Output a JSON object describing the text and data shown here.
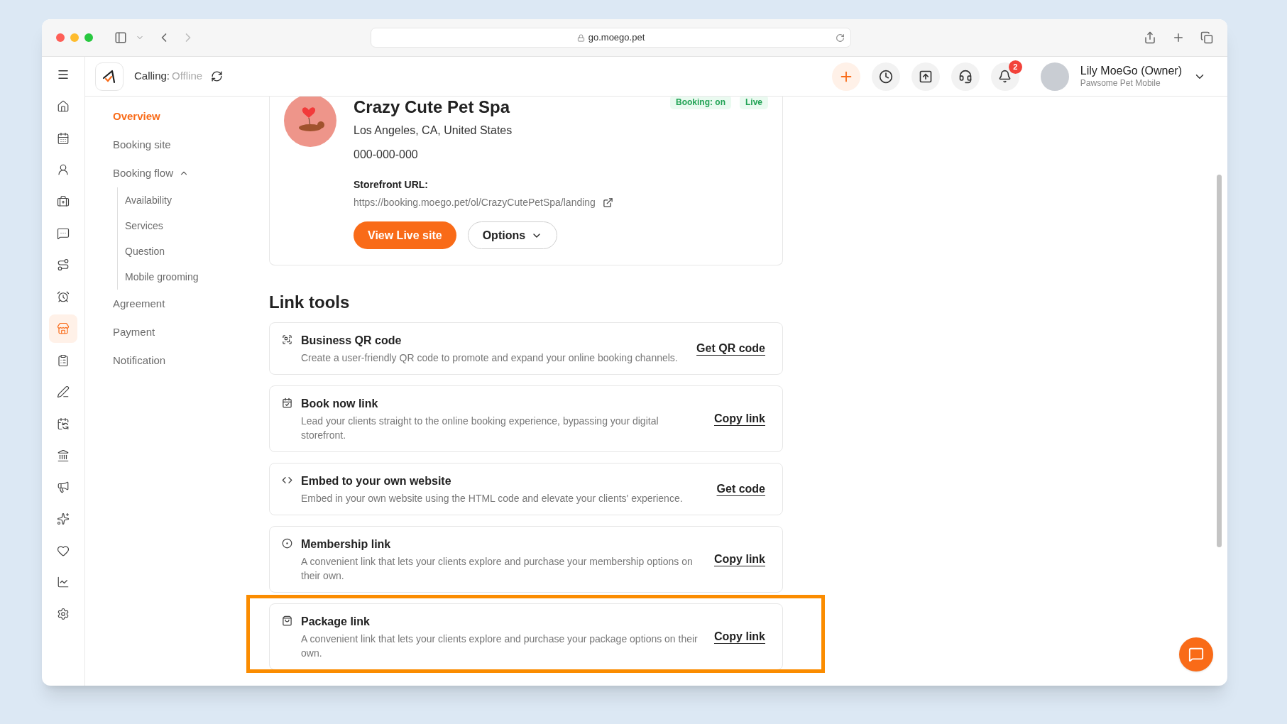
{
  "browser": {
    "url": "go.moego.pet"
  },
  "header": {
    "calling_label": "Calling:",
    "calling_status": "Offline",
    "notification_count": "2",
    "user_name": "Lily MoeGo (Owner)",
    "business_name": "Pawsome Pet Mobile"
  },
  "rail": [
    {
      "selected": false
    },
    {
      "selected": false
    },
    {
      "selected": false
    },
    {
      "selected": false
    },
    {
      "selected": false
    },
    {
      "selected": false
    },
    {
      "selected": false
    },
    {
      "selected": true
    },
    {
      "selected": false
    },
    {
      "selected": false
    },
    {
      "selected": false
    },
    {
      "selected": false
    },
    {
      "selected": false
    },
    {
      "selected": false
    },
    {
      "selected": false
    },
    {
      "selected": false
    },
    {
      "selected": false
    }
  ],
  "subnav": [
    {
      "label": "Overview",
      "selected": true
    },
    {
      "label": "Booking site",
      "selected": false
    },
    {
      "label": "Booking flow",
      "selected": false,
      "expanded": true,
      "children": [
        {
          "label": "Availability",
          "selected": false
        },
        {
          "label": "Services",
          "selected": false
        },
        {
          "label": "Question",
          "selected": false
        },
        {
          "label": "Mobile grooming",
          "selected": false
        }
      ]
    },
    {
      "label": "Agreement",
      "selected": false
    },
    {
      "label": "Payment",
      "selected": false
    },
    {
      "label": "Notification",
      "selected": false
    }
  ],
  "business": {
    "name": "Crazy Cute Pet Spa",
    "address": "Los Angeles, CA, United States",
    "phone": "000-000-000",
    "badges": [
      "Booking: on",
      "Live"
    ],
    "storefront_label": "Storefront URL:",
    "storefront_url": "https://booking.moego.pet/ol/CrazyCutePetSpa/landing",
    "primary_button": "View Live site",
    "options_button": "Options"
  },
  "link_tools": {
    "title": "Link tools",
    "tools": [
      {
        "title": "Business QR code",
        "description": "Create a user-friendly QR code to promote and expand your online booking channels.",
        "action": "Get QR code",
        "highlighted": false
      },
      {
        "title": "Book now link",
        "description": "Lead your clients straight to the online booking experience, bypassing your digital storefront.",
        "action": "Copy link",
        "highlighted": false
      },
      {
        "title": "Embed to your own website",
        "description": "Embed in your own website using the HTML code and elevate your clients' experience.",
        "action": "Get code",
        "highlighted": false
      },
      {
        "title": "Membership link",
        "description": "A convenient link that lets your clients explore and purchase your membership options on their own.",
        "action": "Copy link",
        "highlighted": false
      },
      {
        "title": "Package link",
        "description": "A convenient link that lets your clients explore and purchase your package options on their own.",
        "action": "Copy link",
        "highlighted": true
      }
    ]
  }
}
